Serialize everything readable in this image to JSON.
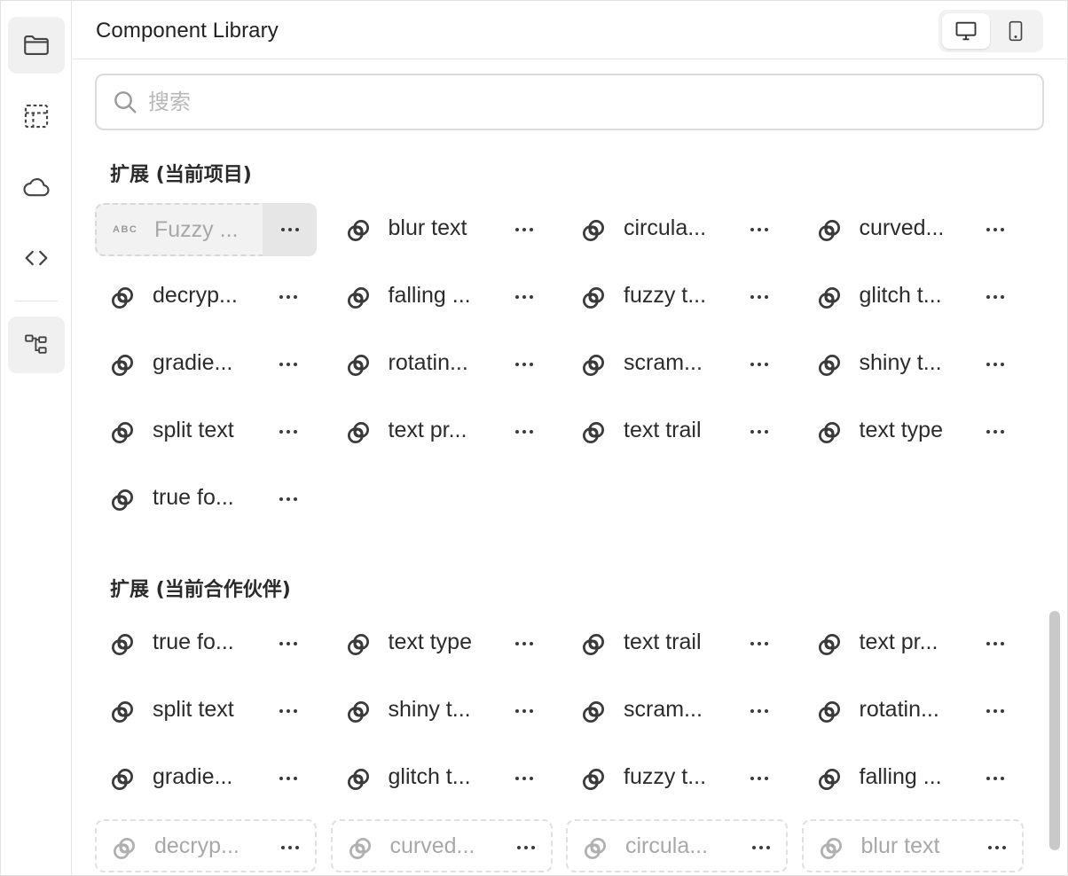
{
  "header": {
    "title": "Component Library"
  },
  "search": {
    "placeholder": "搜索"
  },
  "sections": [
    {
      "title": "扩展 (当前项目)",
      "items": [
        {
          "label": "Fuzzy ...",
          "icon": "abc-text-icon",
          "state": "selected"
        },
        {
          "label": "blur text",
          "icon": "link-rings-icon",
          "state": "normal"
        },
        {
          "label": "circula...",
          "icon": "link-rings-icon",
          "state": "normal"
        },
        {
          "label": "curved...",
          "icon": "link-rings-icon",
          "state": "normal"
        },
        {
          "label": "decryp...",
          "icon": "link-rings-icon",
          "state": "normal"
        },
        {
          "label": "falling ...",
          "icon": "link-rings-icon",
          "state": "normal"
        },
        {
          "label": "fuzzy t...",
          "icon": "link-rings-icon",
          "state": "normal"
        },
        {
          "label": "glitch t...",
          "icon": "link-rings-icon",
          "state": "normal"
        },
        {
          "label": "gradie...",
          "icon": "link-rings-icon",
          "state": "normal"
        },
        {
          "label": "rotatin...",
          "icon": "link-rings-icon",
          "state": "normal"
        },
        {
          "label": "scram...",
          "icon": "link-rings-icon",
          "state": "normal"
        },
        {
          "label": "shiny t...",
          "icon": "link-rings-icon",
          "state": "normal"
        },
        {
          "label": "split text",
          "icon": "link-rings-icon",
          "state": "normal"
        },
        {
          "label": "text pr...",
          "icon": "link-rings-icon",
          "state": "normal"
        },
        {
          "label": "text trail",
          "icon": "link-rings-icon",
          "state": "normal"
        },
        {
          "label": "text type",
          "icon": "link-rings-icon",
          "state": "normal"
        },
        {
          "label": "true fo...",
          "icon": "link-rings-icon",
          "state": "normal"
        }
      ]
    },
    {
      "title": "扩展 (当前合作伙伴)",
      "items": [
        {
          "label": "true fo...",
          "icon": "link-rings-icon",
          "state": "normal"
        },
        {
          "label": "text type",
          "icon": "link-rings-icon",
          "state": "normal"
        },
        {
          "label": "text trail",
          "icon": "link-rings-icon",
          "state": "normal"
        },
        {
          "label": "text pr...",
          "icon": "link-rings-icon",
          "state": "normal"
        },
        {
          "label": "split text",
          "icon": "link-rings-icon",
          "state": "normal"
        },
        {
          "label": "shiny t...",
          "icon": "link-rings-icon",
          "state": "normal"
        },
        {
          "label": "scram...",
          "icon": "link-rings-icon",
          "state": "normal"
        },
        {
          "label": "rotatin...",
          "icon": "link-rings-icon",
          "state": "normal"
        },
        {
          "label": "gradie...",
          "icon": "link-rings-icon",
          "state": "normal"
        },
        {
          "label": "glitch t...",
          "icon": "link-rings-icon",
          "state": "normal"
        },
        {
          "label": "fuzzy t...",
          "icon": "link-rings-icon",
          "state": "normal"
        },
        {
          "label": "falling ...",
          "icon": "link-rings-icon",
          "state": "normal"
        },
        {
          "label": "decryp...",
          "icon": "link-rings-icon",
          "state": "dashed"
        },
        {
          "label": "curved...",
          "icon": "link-rings-icon",
          "state": "dashed"
        },
        {
          "label": "circula...",
          "icon": "link-rings-icon",
          "state": "dashed"
        },
        {
          "label": "blur text",
          "icon": "link-rings-icon",
          "state": "dashed"
        }
      ]
    }
  ],
  "rail": {
    "items": [
      {
        "name": "folder-icon",
        "active": true
      },
      {
        "name": "dashed-frame-icon",
        "active": false
      },
      {
        "name": "cloud-icon",
        "active": false
      },
      {
        "name": "code-brackets-icon",
        "active": false
      },
      {
        "name": "hierarchy-icon",
        "active": true
      }
    ]
  },
  "device_toggle": {
    "selected": "desktop-icon",
    "options": [
      "desktop-icon",
      "mobile-icon"
    ]
  },
  "colors": {
    "icon": "#3a3a3a",
    "muted": "#a8a8a8",
    "selected_bg": "#f2f2f2",
    "border": "#e2e2e2"
  }
}
